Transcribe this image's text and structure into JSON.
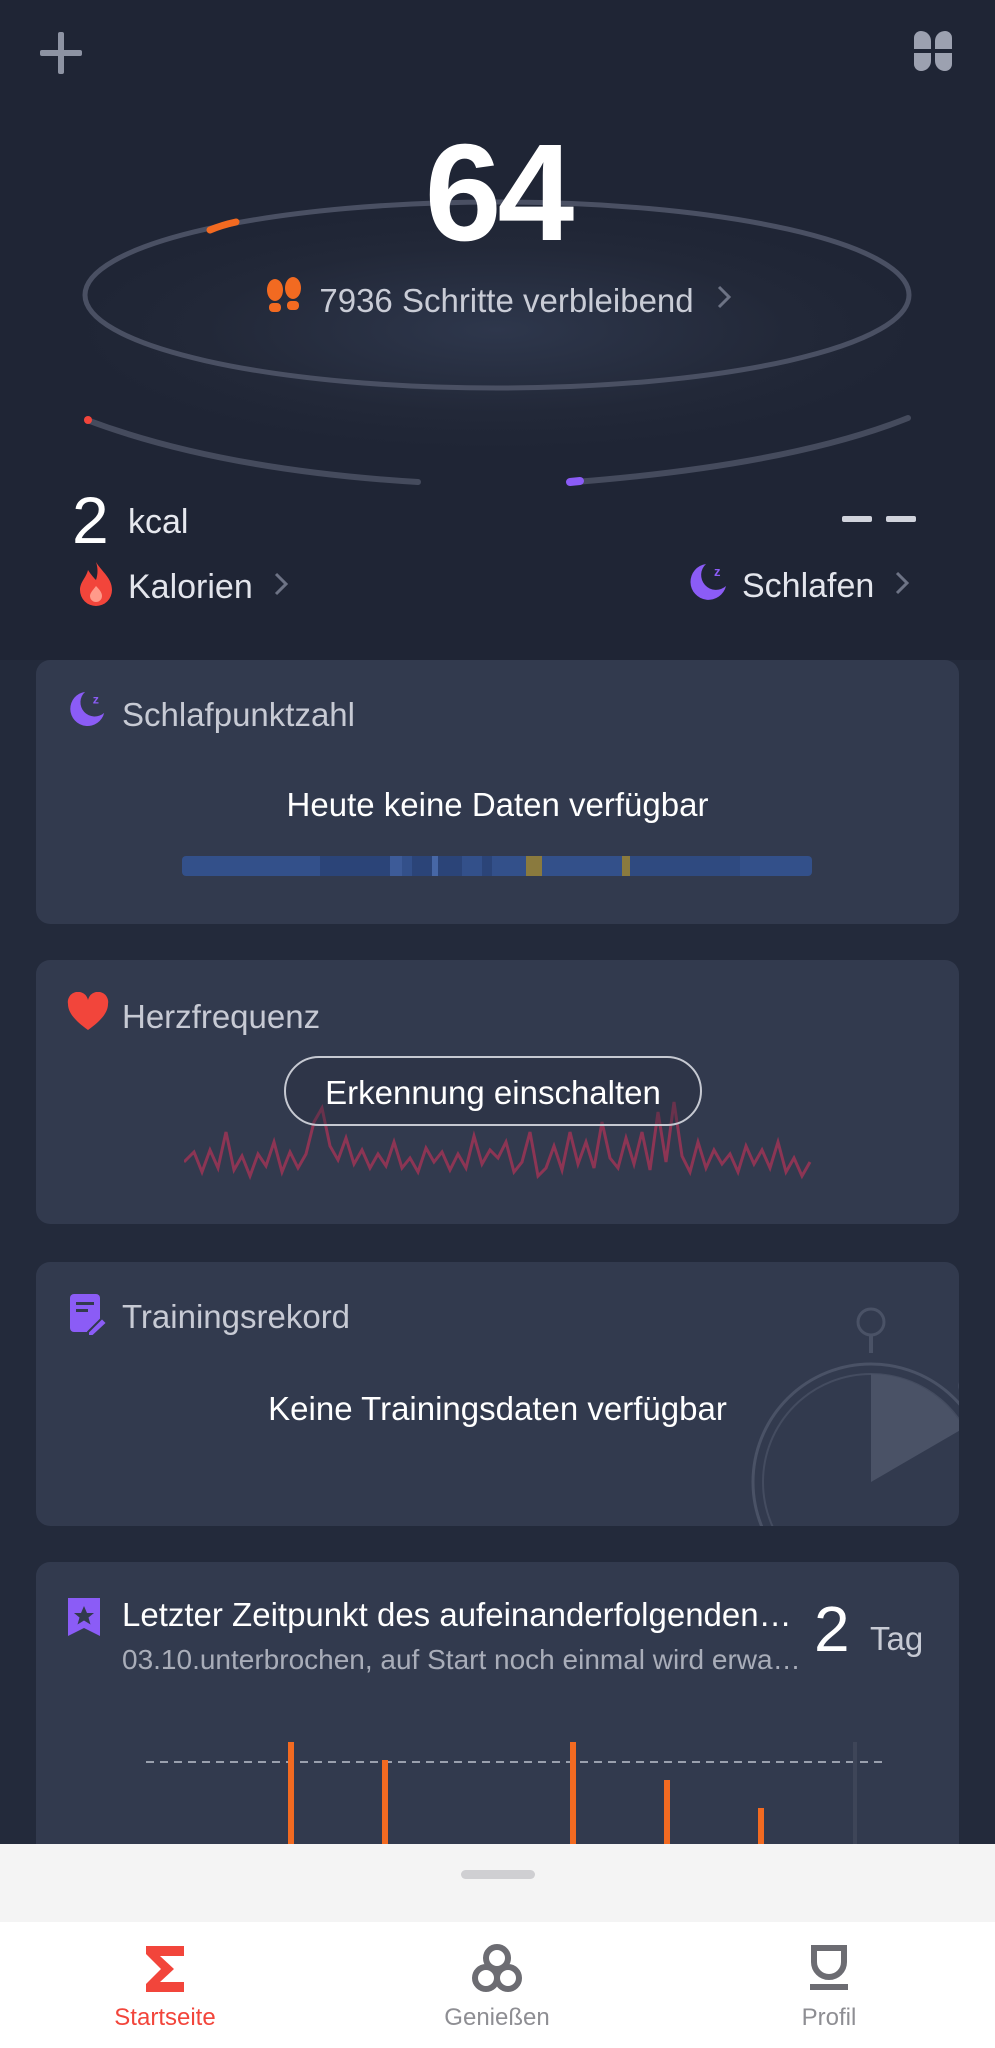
{
  "header": {
    "add_icon": "plus-icon",
    "menu_icon": "four-leaf-grid-icon"
  },
  "activity": {
    "big_value": "64",
    "steps_remaining": "7936 Schritte verbleibend",
    "accent_steps": "#f26a21",
    "accent_sleep": "#8b5cf6",
    "accent_calories": "#f2453b"
  },
  "calories": {
    "value": "2",
    "unit": "kcal",
    "label": "Kalorien"
  },
  "sleep": {
    "value": "– –",
    "label": "Schlafen"
  },
  "cards": {
    "sleep_score": {
      "title": "Schlafpunktzahl",
      "message": "Heute keine Daten verfügbar"
    },
    "heart_rate": {
      "title": "Herzfrequenz",
      "button": "Erkennung einschalten"
    },
    "training": {
      "title": "Trainingsrekord",
      "message": "Keine Trainingsdaten verfügbar"
    },
    "streak": {
      "title": "Letzter Zeitpunkt des aufeinanderfolgenden…",
      "subtitle": "03.10.unterbrochen, auf Start noch einmal wird erwa…",
      "value": "2",
      "unit": "Tag"
    }
  },
  "bottom_nav": {
    "items": [
      {
        "label": "Startseite",
        "icon": "sigma-icon",
        "active": true
      },
      {
        "label": "Genießen",
        "icon": "trefoil-icon",
        "active": false
      },
      {
        "label": "Profil",
        "icon": "profile-icon",
        "active": false
      }
    ]
  }
}
